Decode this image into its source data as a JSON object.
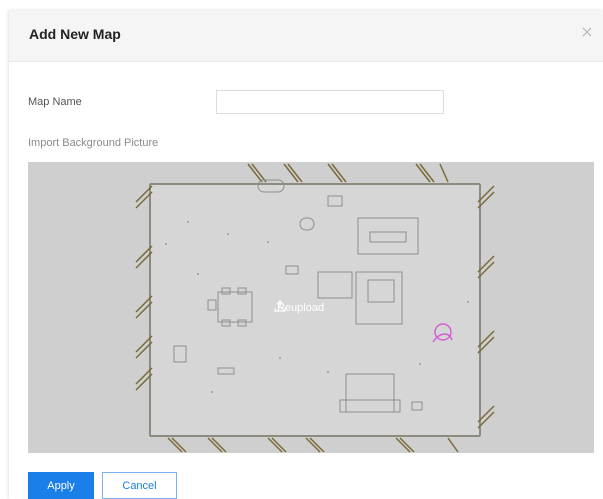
{
  "dialog": {
    "title": "Add New Map",
    "close_icon": "close-icon"
  },
  "form": {
    "map_name_label": "Map Name",
    "map_name_value": "",
    "map_name_placeholder": "",
    "import_label": "Import Background Picture",
    "reupload_label": "Reupload",
    "reupload_icon": "upload-icon"
  },
  "footer": {
    "apply_label": "Apply",
    "cancel_label": "Cancel"
  },
  "colors": {
    "primary": "#1a7fe8",
    "preview_bg": "#cfcfcf",
    "header_bg": "#f5f5f5"
  }
}
